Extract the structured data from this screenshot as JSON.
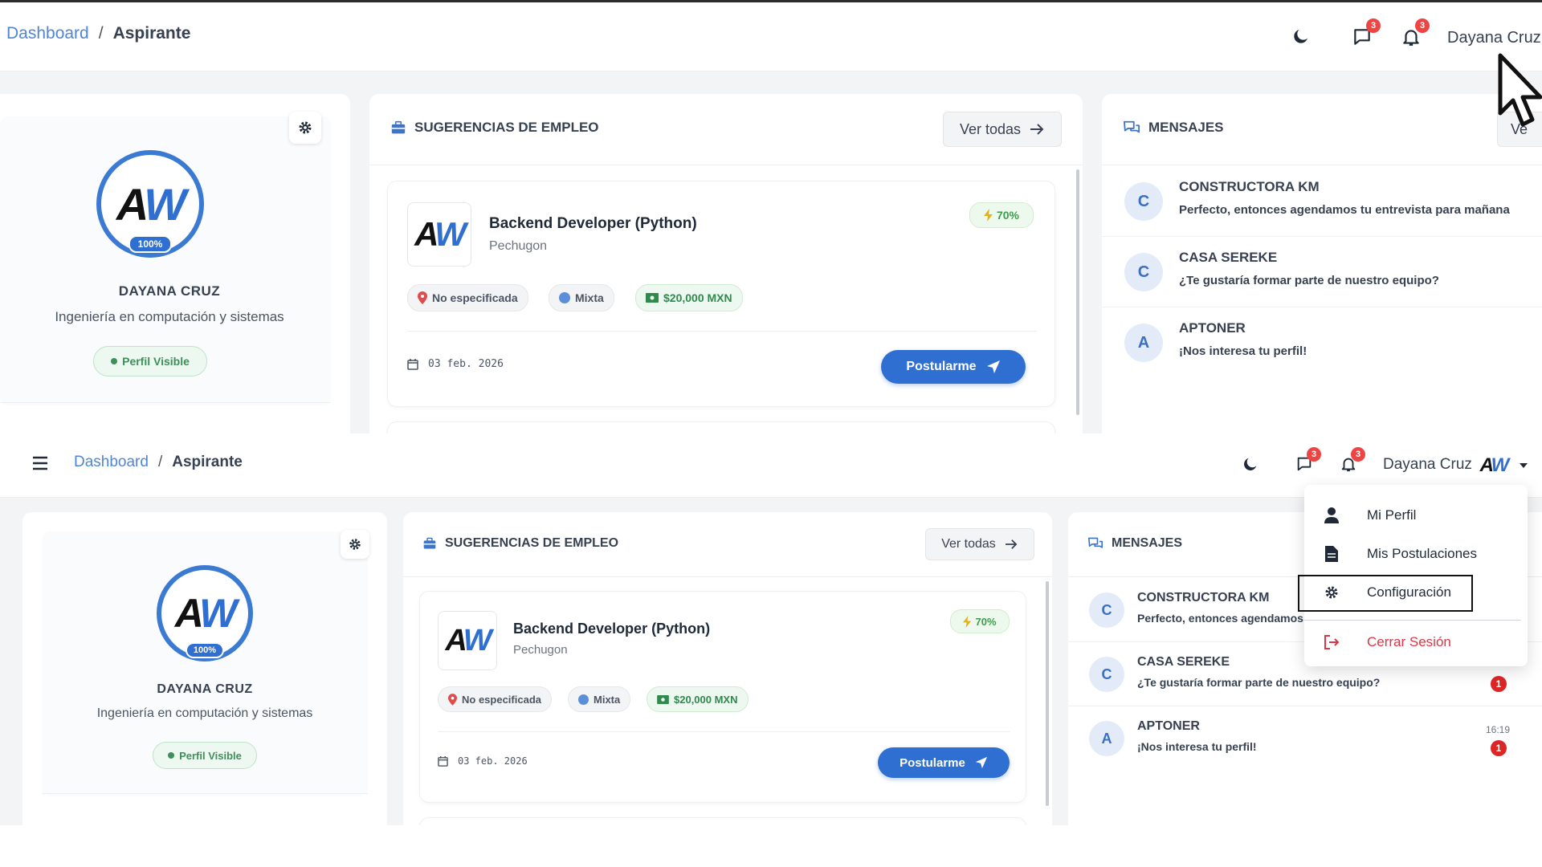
{
  "breadcrumb": {
    "root": "Dashboard",
    "separator": "/",
    "current": "Aspirante"
  },
  "header": {
    "user_name": "Dayana Cruz",
    "messages_count": "3",
    "notifications_count": "3"
  },
  "profile": {
    "logo_a": "A",
    "logo_w": "W",
    "progress": "100%",
    "name": "DAYANA CRUZ",
    "career": "Ingeniería en computación y sistemas",
    "visibility": "Perfil Visible"
  },
  "jobs": {
    "title": "SUGERENCIAS DE EMPLEO",
    "view_all": "Ver todas",
    "items": [
      {
        "title": "Backend Developer (Python)",
        "company": "Pechugon",
        "match": "70%",
        "location": "No especificada",
        "modality": "Mixta",
        "salary": "$20,000 MXN",
        "date": "03 feb. 2026",
        "apply": "Postularme"
      }
    ]
  },
  "messages": {
    "title": "MENSAJES",
    "view_all_partial": "Ve",
    "items": [
      {
        "initial": "C",
        "sender": "CONSTRUCTORA KM",
        "text": "Perfecto, entonces agendamos tu entrevista para mañana",
        "time": "",
        "unread": ""
      },
      {
        "initial": "C",
        "sender": "CASA SEREKE",
        "text": "¿Te gustaría formar parte de nuestro equipo?",
        "time": "",
        "unread": "1"
      },
      {
        "initial": "A",
        "sender": "APTONER",
        "text": "¡Nos interesa tu perfil!",
        "time": "16:19",
        "unread": "1"
      }
    ]
  },
  "user_menu": {
    "items": [
      {
        "label": "Mi Perfil"
      },
      {
        "label": "Mis Postulaciones"
      },
      {
        "label": "Configuración"
      },
      {
        "label": "Cerrar Sesión"
      }
    ]
  },
  "colors": {
    "primary": "#2f6fd1",
    "success": "#3f8f5b",
    "danger": "#dc3545",
    "badge": "#ef4444"
  },
  "icons": {
    "moon": "moon-icon",
    "chat": "chat-icon",
    "bell": "bell-icon",
    "gear": "gear-icon",
    "briefcase": "briefcase-icon",
    "messages": "messages-icon",
    "arrow": "arrow-right-icon",
    "location": "location-pin-icon",
    "modality": "circle-icon",
    "money": "money-icon",
    "calendar": "calendar-icon",
    "send": "send-icon",
    "menu": "hamburger-icon",
    "user": "user-icon",
    "document": "document-icon",
    "logout": "logout-icon",
    "cursor": "cursor-icon"
  }
}
